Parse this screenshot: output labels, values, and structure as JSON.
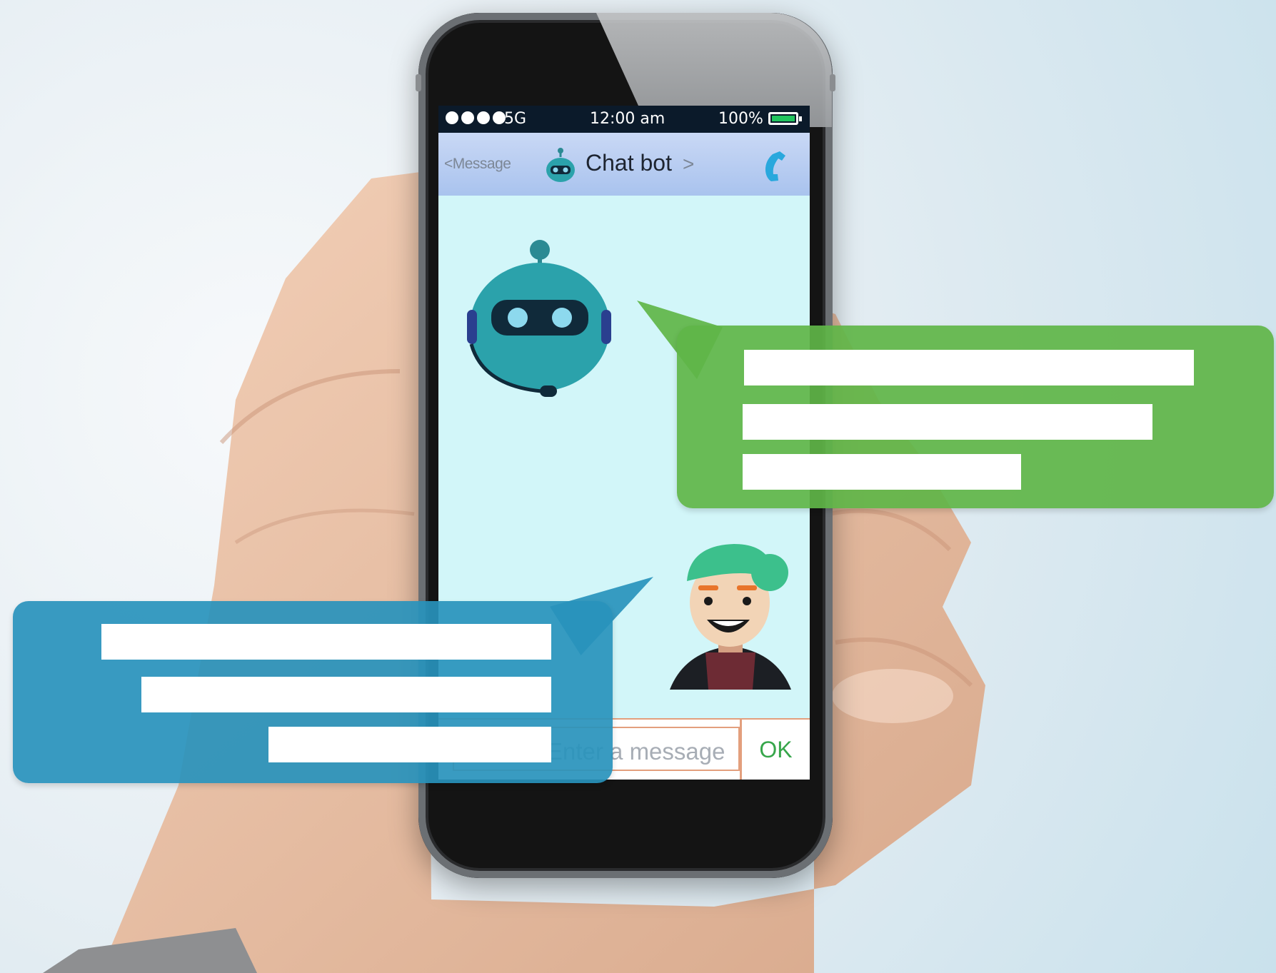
{
  "status_bar": {
    "network": "5G",
    "time": "12:00 am",
    "battery": "100%",
    "battery_level": 1.0,
    "signal_dots": 4
  },
  "nav": {
    "back_label": "<Message",
    "title": "Chat bot",
    "title_chevron": ">",
    "call_icon": "phone-icon"
  },
  "composer": {
    "placeholder": "Enter a message",
    "send_label": "OK"
  },
  "colors": {
    "bot_bubble": "#60b548",
    "user_bubble": "#2892bc",
    "screen_bg": "#d2f6f9",
    "nav_bg": "#b9cff1",
    "ok_text": "#37a64b"
  }
}
